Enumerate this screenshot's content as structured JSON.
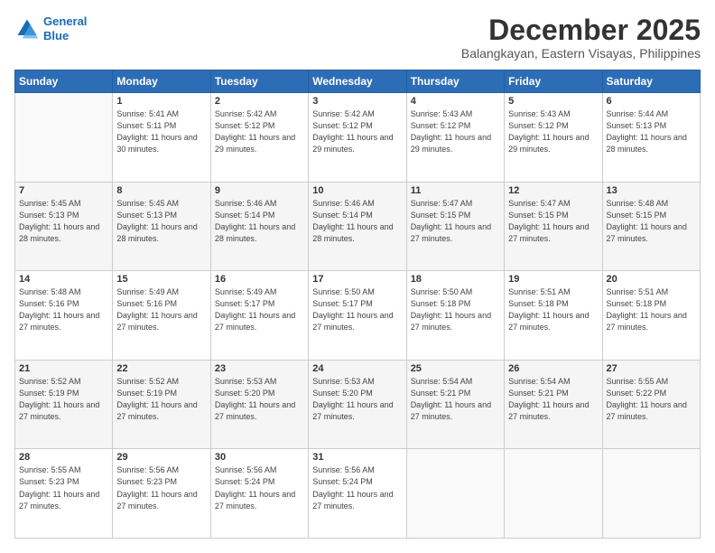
{
  "logo": {
    "line1": "General",
    "line2": "Blue"
  },
  "title": "December 2025",
  "subtitle": "Balangkayan, Eastern Visayas, Philippines",
  "headers": [
    "Sunday",
    "Monday",
    "Tuesday",
    "Wednesday",
    "Thursday",
    "Friday",
    "Saturday"
  ],
  "weeks": [
    [
      {
        "day": "",
        "sunrise": "",
        "sunset": "",
        "daylight": ""
      },
      {
        "day": "1",
        "sunrise": "Sunrise: 5:41 AM",
        "sunset": "Sunset: 5:11 PM",
        "daylight": "Daylight: 11 hours and 30 minutes."
      },
      {
        "day": "2",
        "sunrise": "Sunrise: 5:42 AM",
        "sunset": "Sunset: 5:12 PM",
        "daylight": "Daylight: 11 hours and 29 minutes."
      },
      {
        "day": "3",
        "sunrise": "Sunrise: 5:42 AM",
        "sunset": "Sunset: 5:12 PM",
        "daylight": "Daylight: 11 hours and 29 minutes."
      },
      {
        "day": "4",
        "sunrise": "Sunrise: 5:43 AM",
        "sunset": "Sunset: 5:12 PM",
        "daylight": "Daylight: 11 hours and 29 minutes."
      },
      {
        "day": "5",
        "sunrise": "Sunrise: 5:43 AM",
        "sunset": "Sunset: 5:12 PM",
        "daylight": "Daylight: 11 hours and 29 minutes."
      },
      {
        "day": "6",
        "sunrise": "Sunrise: 5:44 AM",
        "sunset": "Sunset: 5:13 PM",
        "daylight": "Daylight: 11 hours and 28 minutes."
      }
    ],
    [
      {
        "day": "7",
        "sunrise": "Sunrise: 5:45 AM",
        "sunset": "Sunset: 5:13 PM",
        "daylight": "Daylight: 11 hours and 28 minutes."
      },
      {
        "day": "8",
        "sunrise": "Sunrise: 5:45 AM",
        "sunset": "Sunset: 5:13 PM",
        "daylight": "Daylight: 11 hours and 28 minutes."
      },
      {
        "day": "9",
        "sunrise": "Sunrise: 5:46 AM",
        "sunset": "Sunset: 5:14 PM",
        "daylight": "Daylight: 11 hours and 28 minutes."
      },
      {
        "day": "10",
        "sunrise": "Sunrise: 5:46 AM",
        "sunset": "Sunset: 5:14 PM",
        "daylight": "Daylight: 11 hours and 28 minutes."
      },
      {
        "day": "11",
        "sunrise": "Sunrise: 5:47 AM",
        "sunset": "Sunset: 5:15 PM",
        "daylight": "Daylight: 11 hours and 27 minutes."
      },
      {
        "day": "12",
        "sunrise": "Sunrise: 5:47 AM",
        "sunset": "Sunset: 5:15 PM",
        "daylight": "Daylight: 11 hours and 27 minutes."
      },
      {
        "day": "13",
        "sunrise": "Sunrise: 5:48 AM",
        "sunset": "Sunset: 5:15 PM",
        "daylight": "Daylight: 11 hours and 27 minutes."
      }
    ],
    [
      {
        "day": "14",
        "sunrise": "Sunrise: 5:48 AM",
        "sunset": "Sunset: 5:16 PM",
        "daylight": "Daylight: 11 hours and 27 minutes."
      },
      {
        "day": "15",
        "sunrise": "Sunrise: 5:49 AM",
        "sunset": "Sunset: 5:16 PM",
        "daylight": "Daylight: 11 hours and 27 minutes."
      },
      {
        "day": "16",
        "sunrise": "Sunrise: 5:49 AM",
        "sunset": "Sunset: 5:17 PM",
        "daylight": "Daylight: 11 hours and 27 minutes."
      },
      {
        "day": "17",
        "sunrise": "Sunrise: 5:50 AM",
        "sunset": "Sunset: 5:17 PM",
        "daylight": "Daylight: 11 hours and 27 minutes."
      },
      {
        "day": "18",
        "sunrise": "Sunrise: 5:50 AM",
        "sunset": "Sunset: 5:18 PM",
        "daylight": "Daylight: 11 hours and 27 minutes."
      },
      {
        "day": "19",
        "sunrise": "Sunrise: 5:51 AM",
        "sunset": "Sunset: 5:18 PM",
        "daylight": "Daylight: 11 hours and 27 minutes."
      },
      {
        "day": "20",
        "sunrise": "Sunrise: 5:51 AM",
        "sunset": "Sunset: 5:18 PM",
        "daylight": "Daylight: 11 hours and 27 minutes."
      }
    ],
    [
      {
        "day": "21",
        "sunrise": "Sunrise: 5:52 AM",
        "sunset": "Sunset: 5:19 PM",
        "daylight": "Daylight: 11 hours and 27 minutes."
      },
      {
        "day": "22",
        "sunrise": "Sunrise: 5:52 AM",
        "sunset": "Sunset: 5:19 PM",
        "daylight": "Daylight: 11 hours and 27 minutes."
      },
      {
        "day": "23",
        "sunrise": "Sunrise: 5:53 AM",
        "sunset": "Sunset: 5:20 PM",
        "daylight": "Daylight: 11 hours and 27 minutes."
      },
      {
        "day": "24",
        "sunrise": "Sunrise: 5:53 AM",
        "sunset": "Sunset: 5:20 PM",
        "daylight": "Daylight: 11 hours and 27 minutes."
      },
      {
        "day": "25",
        "sunrise": "Sunrise: 5:54 AM",
        "sunset": "Sunset: 5:21 PM",
        "daylight": "Daylight: 11 hours and 27 minutes."
      },
      {
        "day": "26",
        "sunrise": "Sunrise: 5:54 AM",
        "sunset": "Sunset: 5:21 PM",
        "daylight": "Daylight: 11 hours and 27 minutes."
      },
      {
        "day": "27",
        "sunrise": "Sunrise: 5:55 AM",
        "sunset": "Sunset: 5:22 PM",
        "daylight": "Daylight: 11 hours and 27 minutes."
      }
    ],
    [
      {
        "day": "28",
        "sunrise": "Sunrise: 5:55 AM",
        "sunset": "Sunset: 5:23 PM",
        "daylight": "Daylight: 11 hours and 27 minutes."
      },
      {
        "day": "29",
        "sunrise": "Sunrise: 5:56 AM",
        "sunset": "Sunset: 5:23 PM",
        "daylight": "Daylight: 11 hours and 27 minutes."
      },
      {
        "day": "30",
        "sunrise": "Sunrise: 5:56 AM",
        "sunset": "Sunset: 5:24 PM",
        "daylight": "Daylight: 11 hours and 27 minutes."
      },
      {
        "day": "31",
        "sunrise": "Sunrise: 5:56 AM",
        "sunset": "Sunset: 5:24 PM",
        "daylight": "Daylight: 11 hours and 27 minutes."
      },
      {
        "day": "",
        "sunrise": "",
        "sunset": "",
        "daylight": ""
      },
      {
        "day": "",
        "sunrise": "",
        "sunset": "",
        "daylight": ""
      },
      {
        "day": "",
        "sunrise": "",
        "sunset": "",
        "daylight": ""
      }
    ]
  ]
}
